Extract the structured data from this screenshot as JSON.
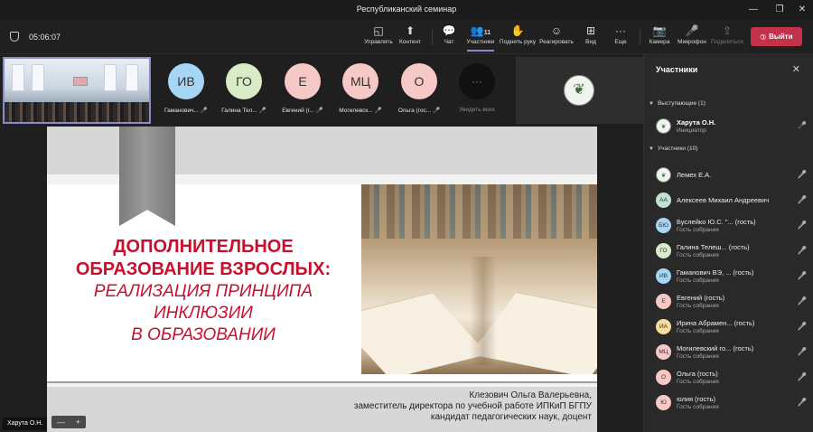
{
  "window": {
    "title": "Республиканский семинар",
    "buttons": [
      "—",
      "❐",
      "✕"
    ]
  },
  "toolbar": {
    "timer": "05:06:07",
    "participants_count": "11",
    "buttons": [
      {
        "label": "Управлять",
        "icon": "◱"
      },
      {
        "label": "Контент",
        "icon": "⬆"
      },
      {
        "label": "Чат",
        "icon": "💬"
      },
      {
        "label": "Участники",
        "icon": "👥"
      },
      {
        "label": "Поднять руку",
        "icon": "✋"
      },
      {
        "label": "Реагировать",
        "icon": "☺"
      },
      {
        "label": "Вид",
        "icon": "⊞"
      },
      {
        "label": "Еще",
        "icon": "···"
      },
      {
        "label": "Камера",
        "icon": "📷"
      },
      {
        "label": "Микрофон",
        "icon": "🎤"
      },
      {
        "label": "Поделиться",
        "icon": "⇪"
      }
    ],
    "leave_label": "Выйти",
    "leave_color": "#c4314b"
  },
  "gallery": [
    {
      "initials": "ИВ",
      "name": "Гаманович...",
      "color": "#a6d6f5"
    },
    {
      "initials": "ГО",
      "name": "Галина Тел...",
      "color": "#d9ecc8"
    },
    {
      "initials": "Е",
      "name": "Евгений (г...",
      "color": "#f6c8c6"
    },
    {
      "initials": "МЦ",
      "name": "Могилевск...",
      "color": "#f6c8c6"
    },
    {
      "initials": "О",
      "name": "Ольга (гос...",
      "color": "#f6c8c6"
    }
  ],
  "see_all": {
    "icon": "···",
    "label": "Увидеть всех"
  },
  "slide": {
    "title_line1": "ДОПОЛНИТЕЛЬНОЕ",
    "title_line2": "ОБРАЗОВАНИЕ ВЗРОСЛЫХ:",
    "subtitle_line1": "РЕАЛИЗАЦИЯ ПРИНЦИПА",
    "subtitle_line2": "ИНКЛЮЗИИ",
    "subtitle_line3": "В ОБРАЗОВАНИИ",
    "author_line1": "Клезович Ольга Валерьевна,",
    "author_line2": "заместитель директора по учебной работе ИПКиП БГПУ",
    "author_line3": "кандидат педагогических наук, доцент"
  },
  "presenter_tag": "Харута О.Н.",
  "zoom": {
    "minus": "—",
    "plus": "+"
  },
  "panel": {
    "title": "Участники",
    "presenters_header": "Выступающие (1)",
    "attendees_header": "Участники (10)",
    "presenter": {
      "name": "Харута О.Н.",
      "role": "Инициатор"
    },
    "attendees": [
      {
        "initials": "",
        "name": "Лемех Е.А.",
        "sub": "",
        "color": "#f0f4ee"
      },
      {
        "initials": "АА",
        "name": "Алексеев Михаил Андреевич",
        "sub": "",
        "color": "#bfe3cf"
      },
      {
        "initials": "БЮ",
        "name": "Буслейко Ю.С. \"...  (гость)",
        "sub": "Гость собрания",
        "color": "#a6d6f5"
      },
      {
        "initials": "ГО",
        "name": "Галина Телеш...   (гость)",
        "sub": "Гость собрания",
        "color": "#d9ecc8"
      },
      {
        "initials": "ИВ",
        "name": "Гаманович ВЭ, ...  (гость)",
        "sub": "Гость собрания",
        "color": "#a6d6f5"
      },
      {
        "initials": "Е",
        "name": "Евгений (гость)",
        "sub": "Гость собрания",
        "color": "#f6c8c6"
      },
      {
        "initials": "ИА",
        "name": "Ирина Абрамен... (гость)",
        "sub": "Гость собрания",
        "color": "#f7dd9a"
      },
      {
        "initials": "МЦ",
        "name": "Могилевский го... (гость)",
        "sub": "Гость собрания",
        "color": "#f6c8c6"
      },
      {
        "initials": "О",
        "name": "Ольга (гость)",
        "sub": "Гость собрания",
        "color": "#f6c8c6"
      },
      {
        "initials": "Ю",
        "name": "юлия (гость)",
        "sub": "Гость собрания",
        "color": "#f6c8c6"
      }
    ]
  }
}
